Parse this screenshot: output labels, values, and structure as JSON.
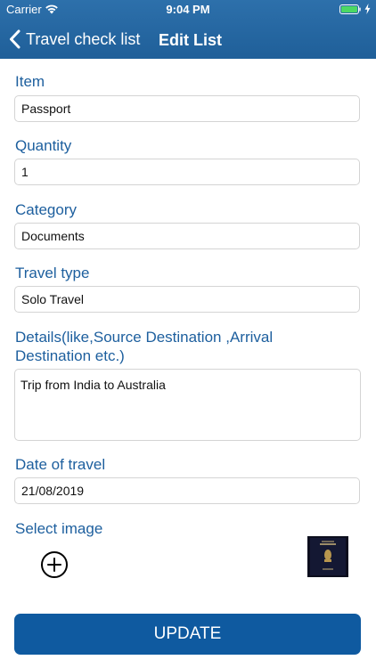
{
  "status_bar": {
    "carrier": "Carrier",
    "time": "9:04 PM",
    "wifi_icon": "wifi-icon",
    "battery_icon": "battery-icon",
    "charging_icon": "charging-bolt-icon"
  },
  "nav": {
    "back_label": "Travel check list",
    "back_icon": "chevron-left-icon",
    "title": "Edit List"
  },
  "form": {
    "item": {
      "label": "Item",
      "value": "Passport"
    },
    "quantity": {
      "label": "Quantity",
      "value": "1"
    },
    "category": {
      "label": "Category",
      "value": "Documents"
    },
    "travel_type": {
      "label": "Travel type",
      "value": "Solo Travel"
    },
    "details": {
      "label": "Details(like,Source Destination ,Arrival Destination etc.)",
      "value": "Trip from India to Australia"
    },
    "date": {
      "label": "Date of travel",
      "value": "21/08/2019"
    },
    "image": {
      "label": "Select image",
      "add_icon": "plus-circle-icon",
      "thumbnail_icon": "passport-cover-thumbnail"
    }
  },
  "actions": {
    "update_label": "UPDATE"
  },
  "colors": {
    "header": "#2466a3",
    "label": "#1d5f9e",
    "button": "#0f5aa0",
    "border": "#d4d4d4"
  }
}
